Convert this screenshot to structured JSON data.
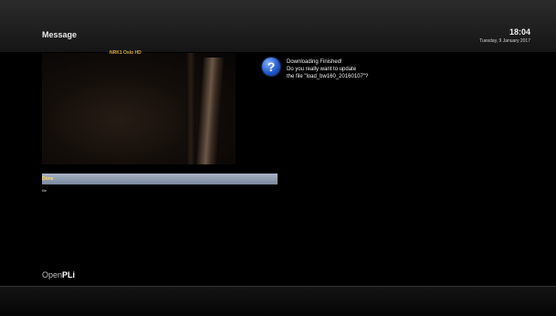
{
  "header": {
    "title": "Message",
    "clock": "18:04",
    "date": "Tuesday, 9 January 2017"
  },
  "preview": {
    "channel_name": "NRK1 Oslo HD"
  },
  "message": {
    "lines": [
      "Downloading Finished!",
      "Do you really want to update",
      "the file \"load_bw160_20160107\"?"
    ]
  },
  "progress": {
    "label": "Done",
    "sub_label": "file",
    "percent": 100
  },
  "footer": {
    "logo_prefix": "Open",
    "logo_suffix": "PLi"
  },
  "colors": {
    "accent": "#ffd75a",
    "progress_fill": "#a7b3c4",
    "question_icon": "#1e55c8"
  },
  "icons": {
    "message_icon": "question-icon"
  }
}
